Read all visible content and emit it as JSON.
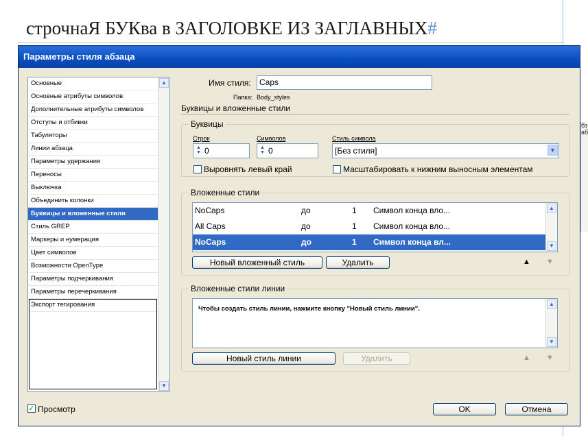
{
  "document": {
    "heading_text": "строчнаЯ БУКва в ЗАГОЛОВКЕ ИЗ ЗАГЛАВНЫХ",
    "end_marker": "#",
    "background_panel_text": "бз аб"
  },
  "dialog": {
    "title": "Параметры стиля абзаца",
    "sidebar": {
      "items": [
        {
          "label": "Основные"
        },
        {
          "label": "Основные атрибуты символов"
        },
        {
          "label": "Дополнительные атрибуты символов"
        },
        {
          "label": "Отступы и отбивки"
        },
        {
          "label": "Табуляторы"
        },
        {
          "label": "Линии абзаца"
        },
        {
          "label": "Параметры удержания"
        },
        {
          "label": "Переносы"
        },
        {
          "label": "Выключка"
        },
        {
          "label": "Объединить колонки"
        },
        {
          "label": "Буквицы и вложенные стили",
          "selected": true
        },
        {
          "label": "Стиль GREP"
        },
        {
          "label": "Маркеры и нумерация"
        },
        {
          "label": "Цвет символов"
        },
        {
          "label": "Возможности OpenType"
        },
        {
          "label": "Параметры подчеркивания"
        },
        {
          "label": "Параметры перечеркивания"
        },
        {
          "label": "Экспорт тегирования"
        }
      ]
    },
    "style_name_label": "Имя стиля:",
    "style_name_value": "Caps",
    "folder_label": "Папка:",
    "folder_value": "Body_styles",
    "section_title": "Буквицы и вложенные стили",
    "drop_caps": {
      "title": "Буквицы",
      "lines_label": "Строк",
      "lines_value": "0",
      "chars_label": "Символов",
      "chars_value": "0",
      "char_style_label": "Стиль символа",
      "char_style_value": "[Без стиля]",
      "align_left_label": "Выровнять левый край",
      "align_left_checked": false,
      "scale_label": "Масштабировать к нижним выносным элементам",
      "scale_checked": false
    },
    "nested_styles": {
      "title": "Вложенные стили",
      "rows": [
        {
          "style": "NoCaps",
          "through": "до",
          "count": "1",
          "end": "Символ конца вло..."
        },
        {
          "style": "All Caps",
          "through": "до",
          "count": "1",
          "end": "Символ конца вло..."
        },
        {
          "style": "NoCaps",
          "through": "до",
          "count": "1",
          "end": "Символ конца вл...",
          "selected": true
        }
      ],
      "new_button": "Новый вложенный стиль",
      "delete_button": "Удалить"
    },
    "line_styles": {
      "title": "Вложенные стили линии",
      "message": "Чтобы создать стиль линии, нажмите кнопку \"Новый стиль линии\".",
      "new_button": "Новый стиль линии",
      "delete_button": "Удалить"
    },
    "preview_label": "Просмотр",
    "preview_checked": true,
    "ok_button": "OK",
    "cancel_button": "Отмена"
  }
}
